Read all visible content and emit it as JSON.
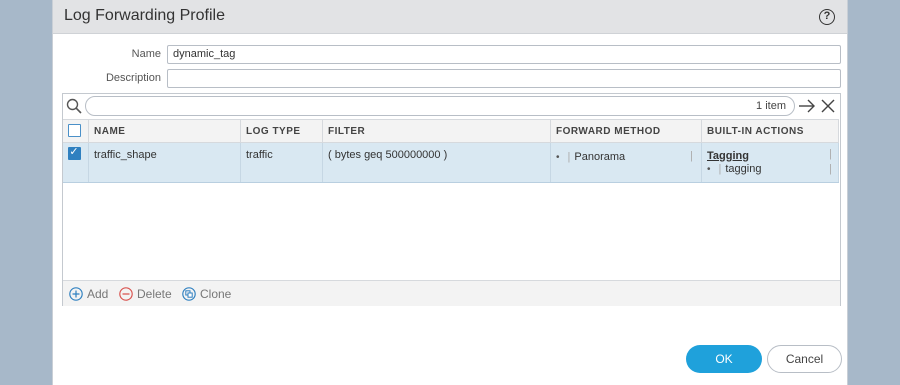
{
  "dialog": {
    "title": "Log Forwarding Profile",
    "help_icon": "?"
  },
  "form": {
    "name_label": "Name",
    "name_value": "dynamic_tag",
    "description_label": "Description",
    "description_value": ""
  },
  "grid": {
    "item_count": "1 item",
    "columns": [
      "NAME",
      "LOG TYPE",
      "FILTER",
      "FORWARD METHOD",
      "BUILT-IN ACTIONS"
    ],
    "rows": [
      {
        "selected": true,
        "name": "traffic_shape",
        "log_type": "traffic",
        "filter": "( bytes geq 500000000 )",
        "forward_method": "Panorama",
        "action_title": "Tagging",
        "action_value": "tagging"
      }
    ]
  },
  "toolbar": {
    "add_label": "Add",
    "delete_label": "Delete",
    "clone_label": "Clone"
  },
  "buttons": {
    "ok_label": "OK",
    "cancel_label": "Cancel"
  },
  "colors": {
    "accent": "#1fa1db",
    "selected_row": "#d9e8f2",
    "delete_red": "#d9534f"
  }
}
